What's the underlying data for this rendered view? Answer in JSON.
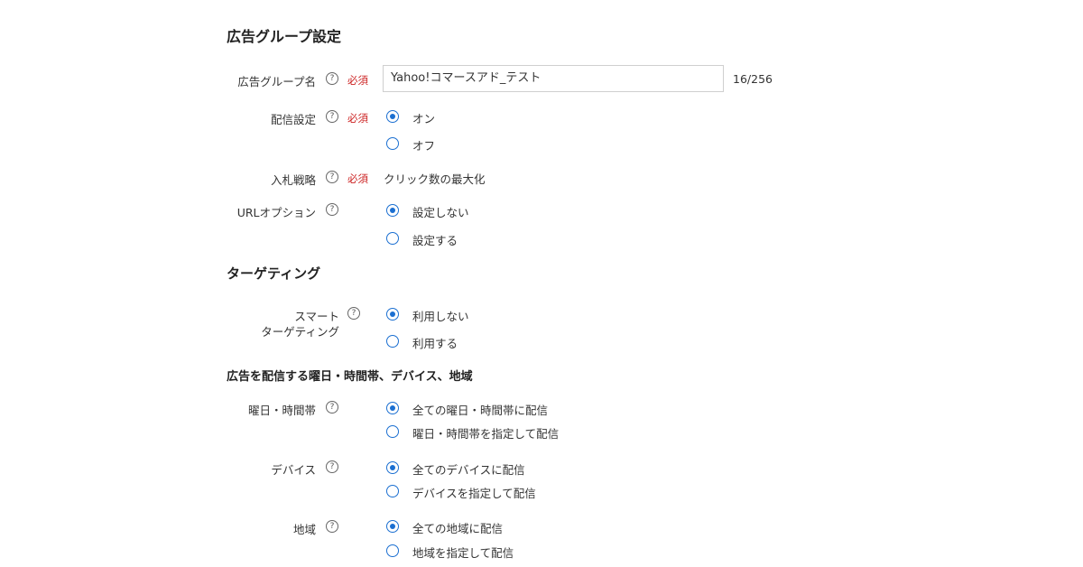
{
  "section_ad_group": {
    "title": "広告グループ設定",
    "required_label": "必須",
    "name_field": {
      "label": "広告グループ名",
      "value": "Yahoo!コマースアド_テスト",
      "counter": "16/256"
    },
    "delivery": {
      "label": "配信設定",
      "options": [
        "オン",
        "オフ"
      ],
      "selected": 0
    },
    "bid_strategy": {
      "label": "入札戦略",
      "value": "クリック数の最大化"
    },
    "url_option": {
      "label": "URLオプション",
      "options": [
        "設定しない",
        "設定する"
      ],
      "selected": 0
    }
  },
  "section_targeting": {
    "title": "ターゲティング",
    "smart_targeting": {
      "label_line1": "スマート",
      "label_line2": "ターゲティング",
      "options": [
        "利用しない",
        "利用する"
      ],
      "selected": 0
    }
  },
  "section_schedule": {
    "title": "広告を配信する曜日・時間帯、デバイス、地域",
    "day_time": {
      "label": "曜日・時間帯",
      "options": [
        "全ての曜日・時間帯に配信",
        "曜日・時間帯を指定して配信"
      ],
      "selected": 0
    },
    "device": {
      "label": "デバイス",
      "options": [
        "全てのデバイスに配信",
        "デバイスを指定して配信"
      ],
      "selected": 0
    },
    "region": {
      "label": "地域",
      "options": [
        "全ての地域に配信",
        "地域を指定して配信"
      ],
      "selected": 0
    }
  },
  "help_icon_text": "?",
  "colors": {
    "accent": "#1b6fd1",
    "required": "#cc2222"
  }
}
